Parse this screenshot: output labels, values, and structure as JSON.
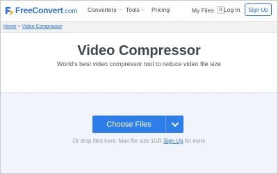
{
  "header": {
    "logo_text": "FreeConvert",
    "logo_suffix": ".com",
    "nav": [
      {
        "label": "Converters"
      },
      {
        "label": "Tools"
      },
      {
        "label": "Pricing"
      }
    ],
    "my_files_label": "My Files",
    "my_files_count": "0",
    "login_label": "Log In",
    "signup_label": "Sign Up"
  },
  "breadcrumb": {
    "home": "Home",
    "separator": ">",
    "current": "Video Compressor"
  },
  "main": {
    "title": "Video Compressor",
    "subtitle": "World's best video compressor tool to reduce video file size"
  },
  "upload": {
    "choose_label": "Choose Files",
    "hint_prefix": "Or drop files here. Max file size 1GB",
    "hint_link": "Sign Up",
    "hint_suffix": "for more"
  },
  "colors": {
    "brand": "#2a6fd6",
    "button": "#2d7ee8",
    "dropzone_bg": "#f1f5fb"
  }
}
